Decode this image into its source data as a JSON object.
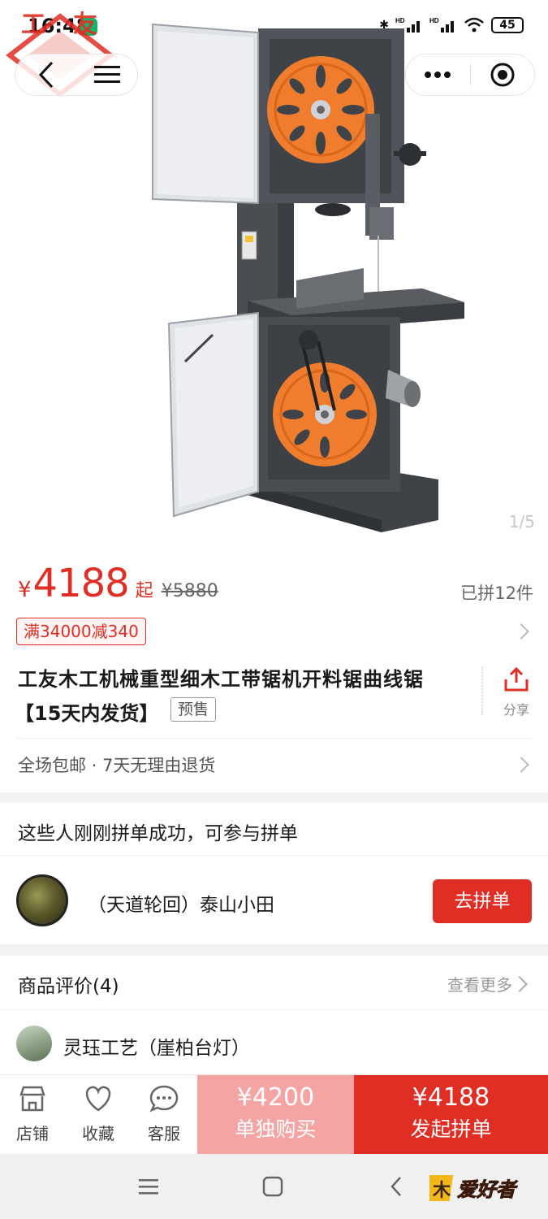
{
  "status_bar": {
    "time": "16:48",
    "battery": "45",
    "signal_labels": [
      "HD",
      "HD"
    ]
  },
  "logo": {
    "text": "工友"
  },
  "nav": {
    "back_icon": "chevron-left-icon",
    "menu_icon": "hamburger-menu-icon",
    "more_icon": "more-dots-icon",
    "close_icon": "target-close-icon"
  },
  "gallery": {
    "counter": "1/5"
  },
  "product": {
    "price_symbol": "¥",
    "price": "4188",
    "price_suffix": "起",
    "original_price": "¥5880",
    "sold": "已拼12件",
    "coupon": "满34000减340",
    "title_line1": "工友木工机械重型细木工带锯机开料锯曲线锯",
    "title_line2": "【15天内发货】",
    "presale_tag": "预售",
    "share_label": "分享",
    "service": "全场包邮 · 7天无理由退货"
  },
  "group_buy": {
    "heading": "这些人刚刚拼单成功，可参与拼单",
    "user": "（天道轮回）泰山小田",
    "join_label": "去拼单"
  },
  "reviews": {
    "heading": "商品评价(4)",
    "more": "查看更多",
    "first_reviewer": "灵珏工艺（崖柏台灯）"
  },
  "action_bar": {
    "store_label": "店铺",
    "favorite_label": "收藏",
    "service_label": "客服",
    "alone_price": "¥4200",
    "alone_label": "单独购买",
    "group_price": "¥4188",
    "group_label": "发起拼单"
  },
  "watermark": {
    "text": "爱好者"
  },
  "colors": {
    "accent_red": "#e02e24",
    "light_red": "#f5a4a4",
    "machine_orange": "#f07d2e",
    "machine_gray": "#4a4e53"
  }
}
